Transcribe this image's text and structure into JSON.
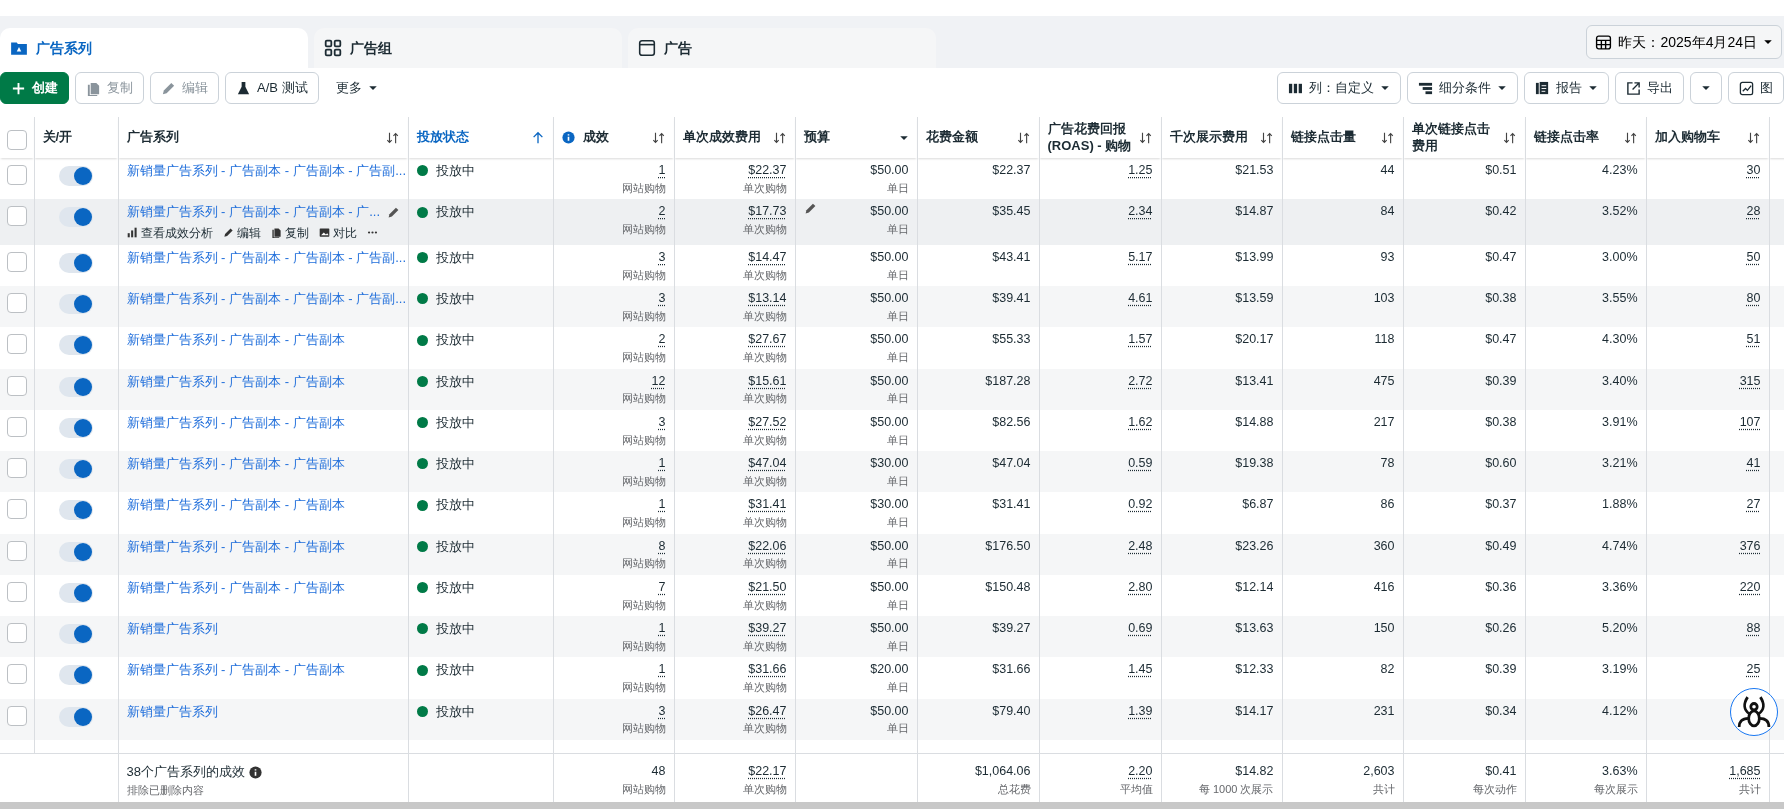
{
  "tabs": [
    {
      "kind": "campaign",
      "label": "广告系列",
      "selected": true
    },
    {
      "kind": "adset",
      "label": "广告组",
      "selected": false
    },
    {
      "kind": "ad",
      "label": "广告",
      "selected": false
    }
  ],
  "date_range": {
    "label": "昨天：2025年4月24日"
  },
  "toolbar": {
    "left": [
      {
        "kind": "create",
        "label": "创建",
        "disabled": false
      },
      {
        "kind": "duplicate",
        "label": "复制",
        "disabled": true
      },
      {
        "kind": "edit",
        "label": "编辑",
        "disabled": true
      },
      {
        "kind": "abtest",
        "label": "A/B 测试",
        "disabled": false
      },
      {
        "kind": "more",
        "label": "更多",
        "disabled": false
      }
    ],
    "right": [
      {
        "kind": "columns",
        "label": "列：自定义"
      },
      {
        "kind": "breakdown",
        "label": "细分条件"
      },
      {
        "kind": "reports",
        "label": "报告"
      },
      {
        "kind": "export",
        "label": "导出"
      },
      {
        "kind": "export-menu"
      },
      {
        "kind": "charts",
        "label": "图"
      }
    ]
  },
  "table": {
    "select_all": {
      "checked": false
    },
    "columns": [
      {
        "label": "关/开",
        "active": false
      },
      {
        "label": "广告系列",
        "sortable": true,
        "active": false
      },
      {
        "label": "投放状态",
        "sortable": true,
        "active": true
      },
      {
        "label": "成效",
        "sortable": true,
        "active": false,
        "info": true
      },
      {
        "label": "单次成效费用",
        "sortable": true,
        "active": false
      },
      {
        "label": "预算",
        "dropdown": true,
        "active": false
      },
      {
        "label": "花费金额",
        "sortable": true,
        "active": false
      },
      {
        "label": "广告花费回报 (ROAS) - 购物",
        "sortable": true,
        "active": false
      },
      {
        "label": "千次展示费用",
        "sortable": true,
        "active": false
      },
      {
        "label": "链接点击量",
        "sortable": true,
        "active": false
      },
      {
        "label": "单次链接点击费用",
        "sortable": true,
        "active": false
      },
      {
        "label": "链接点击率",
        "sortable": true,
        "active": false
      },
      {
        "label": "加入购物车",
        "sortable": true,
        "active": false
      }
    ],
    "rows": [
      {
        "name": "新销量广告系列 - 广告副本 - 广告副本 - 广告副...",
        "selected": false,
        "on": true,
        "hovered": false,
        "status": "投放中",
        "metrics": [
          {
            "value": "1",
            "sub": "网站购物"
          },
          {
            "value": "$22.37",
            "sub": "单次购物"
          },
          {
            "value": "$50.00",
            "sub": "单日"
          },
          {
            "value": "$22.37"
          },
          {
            "value": "1.25"
          },
          {
            "value": "$21.53"
          },
          {
            "value": "44"
          },
          {
            "value": "$0.51"
          },
          {
            "value": "4.23%"
          },
          {
            "value": "30"
          }
        ]
      },
      {
        "name": "新销量广告系列 - 广告副本 - 广告副本 - 广...",
        "selected": false,
        "on": true,
        "hovered": true,
        "status": "投放中",
        "actions": [
          {
            "kind": "insights",
            "label": "查看成效分析"
          },
          {
            "kind": "edit",
            "label": "编辑"
          },
          {
            "kind": "duplicate",
            "label": "复制"
          },
          {
            "kind": "compare",
            "label": "对比"
          },
          {
            "kind": "more"
          }
        ],
        "metrics": [
          {
            "value": "2",
            "sub": "网站购物"
          },
          {
            "value": "$17.73",
            "sub": "单次购物"
          },
          {
            "value": "$50.00",
            "sub": "单日"
          },
          {
            "value": "$35.45"
          },
          {
            "value": "2.34"
          },
          {
            "value": "$14.87"
          },
          {
            "value": "84"
          },
          {
            "value": "$0.42"
          },
          {
            "value": "3.52%"
          },
          {
            "value": "28"
          }
        ]
      },
      {
        "name": "新销量广告系列 - 广告副本 - 广告副本 - 广告副...",
        "selected": false,
        "on": true,
        "hovered": false,
        "status": "投放中",
        "metrics": [
          {
            "value": "3",
            "sub": "网站购物"
          },
          {
            "value": "$14.47",
            "sub": "单次购物"
          },
          {
            "value": "$50.00",
            "sub": "单日"
          },
          {
            "value": "$43.41"
          },
          {
            "value": "5.17"
          },
          {
            "value": "$13.99"
          },
          {
            "value": "93"
          },
          {
            "value": "$0.47"
          },
          {
            "value": "3.00%"
          },
          {
            "value": "50"
          }
        ]
      },
      {
        "name": "新销量广告系列 - 广告副本 - 广告副本 - 广告副...",
        "selected": false,
        "on": true,
        "hovered": false,
        "status": "投放中",
        "metrics": [
          {
            "value": "3",
            "sub": "网站购物"
          },
          {
            "value": "$13.14",
            "sub": "单次购物"
          },
          {
            "value": "$50.00",
            "sub": "单日"
          },
          {
            "value": "$39.41"
          },
          {
            "value": "4.61"
          },
          {
            "value": "$13.59"
          },
          {
            "value": "103"
          },
          {
            "value": "$0.38"
          },
          {
            "value": "3.55%"
          },
          {
            "value": "80"
          }
        ]
      },
      {
        "name": "新销量广告系列 - 广告副本 - 广告副本",
        "selected": false,
        "on": true,
        "hovered": false,
        "status": "投放中",
        "metrics": [
          {
            "value": "2",
            "sub": "网站购物"
          },
          {
            "value": "$27.67",
            "sub": "单次购物"
          },
          {
            "value": "$50.00",
            "sub": "单日"
          },
          {
            "value": "$55.33"
          },
          {
            "value": "1.57"
          },
          {
            "value": "$20.17"
          },
          {
            "value": "118"
          },
          {
            "value": "$0.47"
          },
          {
            "value": "4.30%"
          },
          {
            "value": "51"
          }
        ]
      },
      {
        "name": "新销量广告系列 - 广告副本 - 广告副本",
        "selected": false,
        "on": true,
        "hovered": false,
        "status": "投放中",
        "metrics": [
          {
            "value": "12",
            "sub": "网站购物"
          },
          {
            "value": "$15.61",
            "sub": "单次购物"
          },
          {
            "value": "$50.00",
            "sub": "单日"
          },
          {
            "value": "$187.28"
          },
          {
            "value": "2.72"
          },
          {
            "value": "$13.41"
          },
          {
            "value": "475"
          },
          {
            "value": "$0.39"
          },
          {
            "value": "3.40%"
          },
          {
            "value": "315"
          }
        ]
      },
      {
        "name": "新销量广告系列 - 广告副本 - 广告副本",
        "selected": false,
        "on": true,
        "hovered": false,
        "status": "投放中",
        "metrics": [
          {
            "value": "3",
            "sub": "网站购物"
          },
          {
            "value": "$27.52",
            "sub": "单次购物"
          },
          {
            "value": "$50.00",
            "sub": "单日"
          },
          {
            "value": "$82.56"
          },
          {
            "value": "1.62"
          },
          {
            "value": "$14.88"
          },
          {
            "value": "217"
          },
          {
            "value": "$0.38"
          },
          {
            "value": "3.91%"
          },
          {
            "value": "107"
          }
        ]
      },
      {
        "name": "新销量广告系列 - 广告副本 - 广告副本",
        "selected": false,
        "on": true,
        "hovered": false,
        "status": "投放中",
        "metrics": [
          {
            "value": "1",
            "sub": "网站购物"
          },
          {
            "value": "$47.04",
            "sub": "单次购物"
          },
          {
            "value": "$30.00",
            "sub": "单日"
          },
          {
            "value": "$47.04"
          },
          {
            "value": "0.59"
          },
          {
            "value": "$19.38"
          },
          {
            "value": "78"
          },
          {
            "value": "$0.60"
          },
          {
            "value": "3.21%"
          },
          {
            "value": "41"
          }
        ]
      },
      {
        "name": "新销量广告系列 - 广告副本 - 广告副本",
        "selected": false,
        "on": true,
        "hovered": false,
        "status": "投放中",
        "metrics": [
          {
            "value": "1",
            "sub": "网站购物"
          },
          {
            "value": "$31.41",
            "sub": "单次购物"
          },
          {
            "value": "$30.00",
            "sub": "单日"
          },
          {
            "value": "$31.41"
          },
          {
            "value": "0.92"
          },
          {
            "value": "$6.87"
          },
          {
            "value": "86"
          },
          {
            "value": "$0.37"
          },
          {
            "value": "1.88%"
          },
          {
            "value": "27"
          }
        ]
      },
      {
        "name": "新销量广告系列 - 广告副本 - 广告副本",
        "selected": false,
        "on": true,
        "hovered": false,
        "status": "投放中",
        "metrics": [
          {
            "value": "8",
            "sub": "网站购物"
          },
          {
            "value": "$22.06",
            "sub": "单次购物"
          },
          {
            "value": "$50.00",
            "sub": "单日"
          },
          {
            "value": "$176.50"
          },
          {
            "value": "2.48"
          },
          {
            "value": "$23.26"
          },
          {
            "value": "360"
          },
          {
            "value": "$0.49"
          },
          {
            "value": "4.74%"
          },
          {
            "value": "376"
          }
        ]
      },
      {
        "name": "新销量广告系列 - 广告副本 - 广告副本",
        "selected": false,
        "on": true,
        "hovered": false,
        "status": "投放中",
        "metrics": [
          {
            "value": "7",
            "sub": "网站购物"
          },
          {
            "value": "$21.50",
            "sub": "单次购物"
          },
          {
            "value": "$50.00",
            "sub": "单日"
          },
          {
            "value": "$150.48"
          },
          {
            "value": "2.80"
          },
          {
            "value": "$12.14"
          },
          {
            "value": "416"
          },
          {
            "value": "$0.36"
          },
          {
            "value": "3.36%"
          },
          {
            "value": "220"
          }
        ]
      },
      {
        "name": "新销量广告系列",
        "selected": false,
        "on": true,
        "hovered": false,
        "status": "投放中",
        "metrics": [
          {
            "value": "1",
            "sub": "网站购物"
          },
          {
            "value": "$39.27",
            "sub": "单次购物"
          },
          {
            "value": "$50.00",
            "sub": "单日"
          },
          {
            "value": "$39.27"
          },
          {
            "value": "0.69"
          },
          {
            "value": "$13.63"
          },
          {
            "value": "150"
          },
          {
            "value": "$0.26"
          },
          {
            "value": "5.20%"
          },
          {
            "value": "88"
          }
        ]
      },
      {
        "name": "新销量广告系列 - 广告副本 - 广告副本",
        "selected": false,
        "on": true,
        "hovered": false,
        "status": "投放中",
        "metrics": [
          {
            "value": "1",
            "sub": "网站购物"
          },
          {
            "value": "$31.66",
            "sub": "单次购物"
          },
          {
            "value": "$20.00",
            "sub": "单日"
          },
          {
            "value": "$31.66"
          },
          {
            "value": "1.45"
          },
          {
            "value": "$12.33"
          },
          {
            "value": "82"
          },
          {
            "value": "$0.39"
          },
          {
            "value": "3.19%"
          },
          {
            "value": "25"
          }
        ]
      },
      {
        "name": "新销量广告系列",
        "selected": false,
        "on": true,
        "hovered": false,
        "status": "投放中",
        "metrics": [
          {
            "value": "3",
            "sub": "网站购物"
          },
          {
            "value": "$26.47",
            "sub": "单次购物"
          },
          {
            "value": "$50.00",
            "sub": "单日"
          },
          {
            "value": "$79.40"
          },
          {
            "value": "1.39"
          },
          {
            "value": "$14.17"
          },
          {
            "value": "231"
          },
          {
            "value": "$0.34"
          },
          {
            "value": "4.12%"
          }
        ]
      }
    ],
    "footer": {
      "title": "38个广告系列的成效",
      "note": "排除已删除内容",
      "metrics": [
        {
          "value": "48",
          "sub": "网站购物"
        },
        {
          "value": "$22.17",
          "sub": "单次购物"
        },
        {
          "value": "$1,064.06",
          "sub": "总花费"
        },
        {
          "value": "2.20",
          "sub": "平均值"
        },
        {
          "value": "$14.82",
          "sub": "每 1000 次展示"
        },
        {
          "value": "2,603",
          "sub": "共计"
        },
        {
          "value": "$0.41",
          "sub": "每次动作"
        },
        {
          "value": "3.63%",
          "sub": "每次展示"
        },
        {
          "value": "1,685",
          "sub": "共计"
        }
      ]
    }
  }
}
